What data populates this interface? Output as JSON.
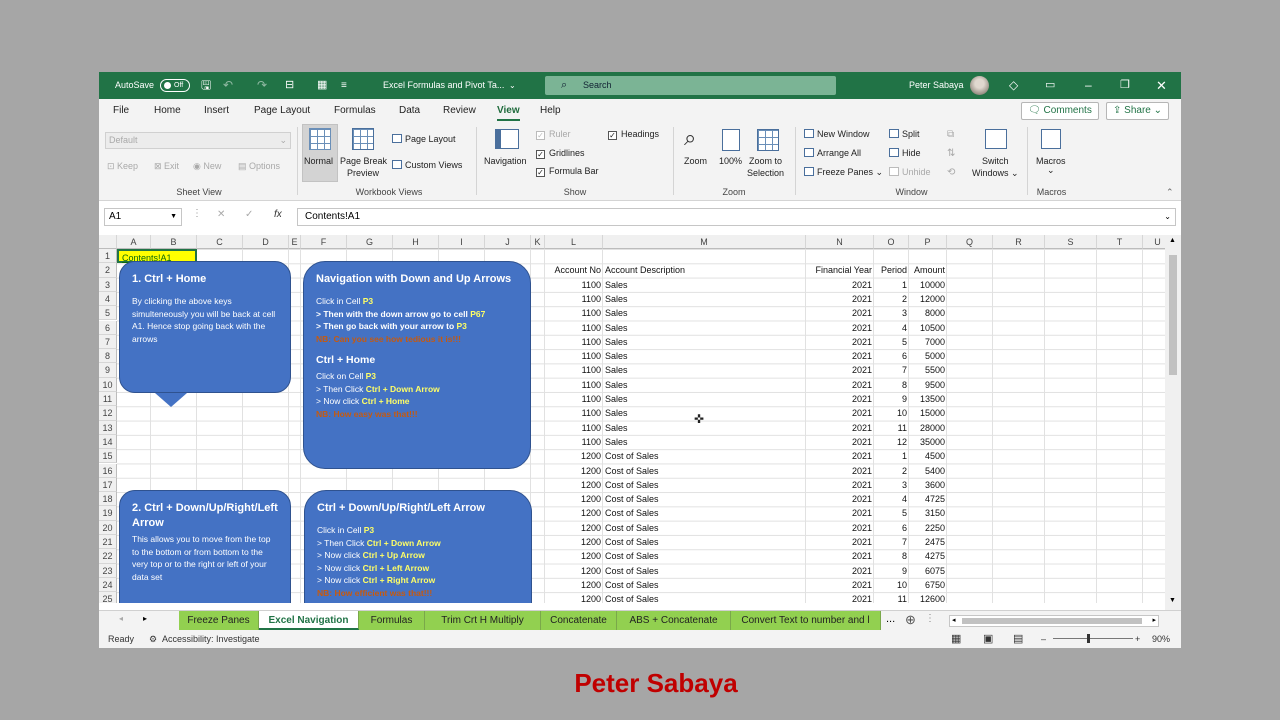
{
  "titlebar": {
    "autosave_label": "AutoSave",
    "autosave_state": "Off",
    "filename": "Excel Formulas and Pivot Ta...",
    "search_placeholder": "Search",
    "user_name": "Peter Sabaya"
  },
  "menu": {
    "tabs": [
      "File",
      "Home",
      "Insert",
      "Page Layout",
      "Formulas",
      "Data",
      "Review",
      "View",
      "Help"
    ],
    "active": "View",
    "comments_label": "Comments",
    "share_label": "Share"
  },
  "ribbon": {
    "sheetview": {
      "dropdown": "Default",
      "keep": "Keep",
      "exit": "Exit",
      "new": "New",
      "options": "Options",
      "label": "Sheet View"
    },
    "workbook": {
      "normal": "Normal",
      "page_break": "Page Break",
      "preview": "Preview",
      "page_layout": "Page Layout",
      "custom_views": "Custom Views",
      "label": "Workbook Views"
    },
    "show": {
      "navigation": "Navigation",
      "ruler": "Ruler",
      "gridlines": "Gridlines",
      "formula_bar": "Formula Bar",
      "headings": "Headings",
      "label": "Show"
    },
    "zoom": {
      "zoom": "Zoom",
      "hundred": "100%",
      "zoom_to": "Zoom to",
      "selection": "Selection",
      "label": "Zoom"
    },
    "window": {
      "new_window": "New Window",
      "arrange_all": "Arrange All",
      "freeze_panes": "Freeze Panes",
      "split": "Split",
      "hide": "Hide",
      "unhide": "Unhide",
      "switch": "Switch",
      "windows": "Windows",
      "label": "Window"
    },
    "macros": {
      "macros": "Macros",
      "label": "Macros"
    }
  },
  "formula_bar": {
    "name_box": "A1",
    "fx": "fx",
    "content": "Contents!A1"
  },
  "grid": {
    "columns": [
      "A",
      "B",
      "C",
      "D",
      "E",
      "F",
      "G",
      "H",
      "I",
      "J",
      "K",
      "L",
      "M",
      "N",
      "O",
      "P",
      "Q",
      "R",
      "S",
      "T",
      "U"
    ],
    "rows": [
      "1",
      "2",
      "3",
      "4",
      "5",
      "6",
      "7",
      "8",
      "9",
      "10",
      "11",
      "12",
      "13",
      "14",
      "15",
      "16",
      "17",
      "18",
      "19",
      "20",
      "21",
      "22",
      "23",
      "24",
      "25"
    ],
    "a1_link": "Contents!A1",
    "headers": {
      "acct": "Account No",
      "desc": "Account Description",
      "year": "Financial Year",
      "period": "Period",
      "amount": "Amount"
    },
    "data": [
      [
        "1100",
        "Sales",
        "2021",
        "1",
        "10000"
      ],
      [
        "1100",
        "Sales",
        "2021",
        "2",
        "12000"
      ],
      [
        "1100",
        "Sales",
        "2021",
        "3",
        "8000"
      ],
      [
        "1100",
        "Sales",
        "2021",
        "4",
        "10500"
      ],
      [
        "1100",
        "Sales",
        "2021",
        "5",
        "7000"
      ],
      [
        "1100",
        "Sales",
        "2021",
        "6",
        "5000"
      ],
      [
        "1100",
        "Sales",
        "2021",
        "7",
        "5500"
      ],
      [
        "1100",
        "Sales",
        "2021",
        "8",
        "9500"
      ],
      [
        "1100",
        "Sales",
        "2021",
        "9",
        "13500"
      ],
      [
        "1100",
        "Sales",
        "2021",
        "10",
        "15000"
      ],
      [
        "1100",
        "Sales",
        "2021",
        "11",
        "28000"
      ],
      [
        "1100",
        "Sales",
        "2021",
        "12",
        "35000"
      ],
      [
        "1200",
        "Cost of Sales",
        "2021",
        "1",
        "4500"
      ],
      [
        "1200",
        "Cost of Sales",
        "2021",
        "2",
        "5400"
      ],
      [
        "1200",
        "Cost of Sales",
        "2021",
        "3",
        "3600"
      ],
      [
        "1200",
        "Cost of Sales",
        "2021",
        "4",
        "4725"
      ],
      [
        "1200",
        "Cost of Sales",
        "2021",
        "5",
        "3150"
      ],
      [
        "1200",
        "Cost of Sales",
        "2021",
        "6",
        "2250"
      ],
      [
        "1200",
        "Cost of Sales",
        "2021",
        "7",
        "2475"
      ],
      [
        "1200",
        "Cost of Sales",
        "2021",
        "8",
        "4275"
      ],
      [
        "1200",
        "Cost of Sales",
        "2021",
        "9",
        "6075"
      ],
      [
        "1200",
        "Cost of Sales",
        "2021",
        "10",
        "6750"
      ],
      [
        "1200",
        "Cost of Sales",
        "2021",
        "11",
        "12600"
      ]
    ]
  },
  "bubbles": {
    "b1": {
      "title": "1. Ctrl + Home",
      "body": "By clicking the above keys simulteneously you will be back at cell A1. Hence stop going back with the arrows"
    },
    "b2": {
      "title": "Navigation with Down and Up Arrows",
      "l1a": "Click in Cell ",
      "l1b": "P3",
      "l2a": "> Then with the down arrow go to cell ",
      "l2b": "P67",
      "l3a": "> Then go back with your arrow to ",
      "l3b": "P3",
      "l4": "NB: Can you see how tedious it is!!!",
      "sub": "Ctrl + Home",
      "s1a": "Click on Cell ",
      "s1b": "P3",
      "s2a": "> Then Click ",
      "s2b": "Ctrl + Down Arrow",
      "s3a": "> Now click ",
      "s3b": "Ctrl + Home",
      "s4": "NB: How easy was that!!!"
    },
    "b3": {
      "title": "2. Ctrl + Down/Up/Right/Left Arrow",
      "body": "This allows you to move from the top to the bottom or from bottom to the very top  or to the right or left  of your data set"
    },
    "b4": {
      "title": "Ctrl + Down/Up/Right/Left Arrow",
      "l1a": "Click in Cell ",
      "l1b": "P3",
      "l2a": "> Then Click ",
      "l2b": "Ctrl + Down Arrow",
      "l3a": "> Now click ",
      "l3b": "Ctrl +  Up Arrow",
      "l4a": "> Now click ",
      "l4b": "Ctrl +  Left Arrow",
      "l5a": "> Now click ",
      "l5b": "Ctrl +  Right Arrow",
      "l6": "NB: How efficient was that!!!"
    }
  },
  "sheets": {
    "tabs": [
      "Freeze Panes",
      "Excel Navigation",
      "Formulas",
      "Trim Crt H Multiply",
      "Concatenate",
      "ABS + Concatenate",
      "Convert Text to number and l"
    ],
    "active": "Excel Navigation",
    "more": "..."
  },
  "status": {
    "ready": "Ready",
    "accessibility": "Accessibility: Investigate",
    "zoom": "90%"
  },
  "footer": "Peter Sabaya"
}
